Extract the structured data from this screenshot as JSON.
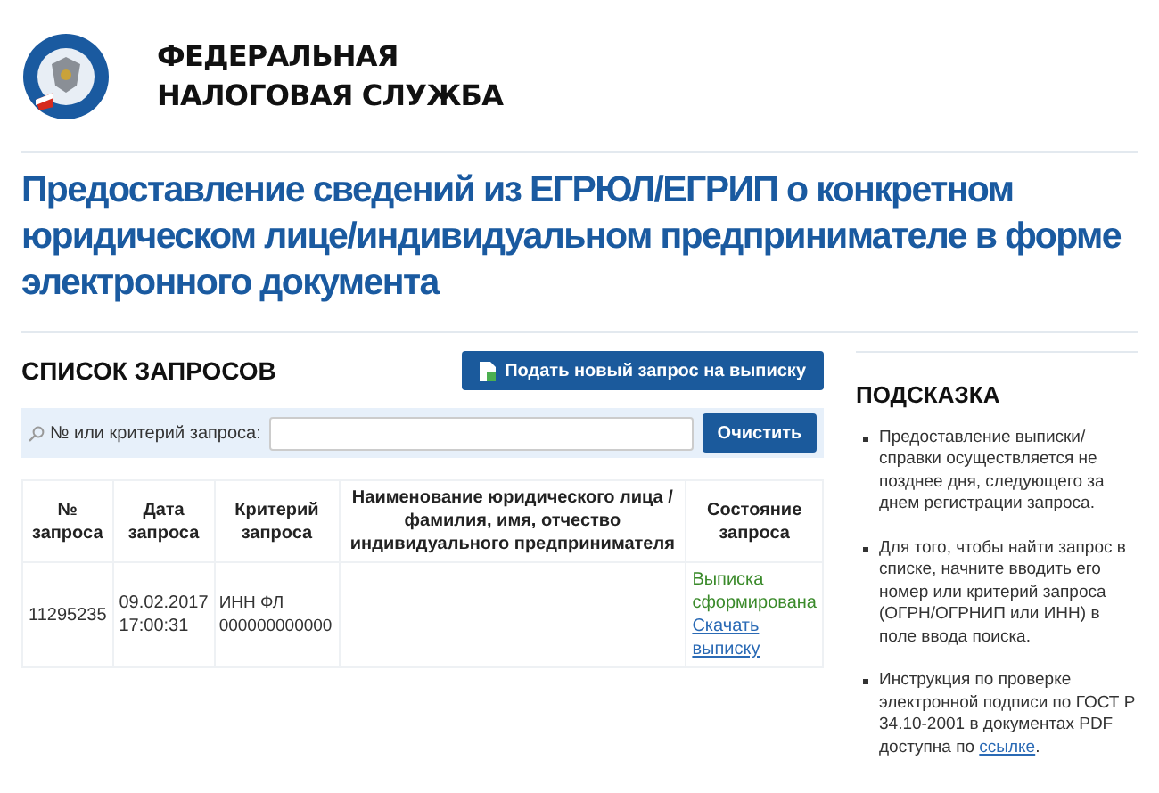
{
  "header": {
    "org_line1": "ФЕДЕРАЛЬНАЯ",
    "org_line2": "НАЛОГОВАЯ СЛУЖБА"
  },
  "page_title": "Предоставление сведений из ЕГРЮЛ/ЕГРИП о конкретном юридическом лице/индивидуальном предпринимателе в форме электронного документа",
  "requests": {
    "heading": "СПИСОК ЗАПРОСОВ",
    "new_request_button": "Подать новый запрос на выписку",
    "search": {
      "label": "№ или критерий запроса:",
      "clear_button": "Очистить"
    },
    "table": {
      "columns": [
        "№ запроса",
        "Дата запроса",
        "Критерий запроса",
        "Наименование юридического лица / фамилия, имя, отчество индивидуального предпринимателя",
        "Состояние запроса"
      ],
      "rows": [
        {
          "number": "11295235",
          "date": "09.02.2017",
          "time": "17:00:31",
          "criterion": "ИНН ФЛ 000000000000",
          "status": "Выписка сформирована",
          "download_link": "Скачать выписку"
        }
      ]
    }
  },
  "hint": {
    "heading": "ПОДСКАЗКА",
    "items": [
      {
        "text": "Предоставление выписки/ справки осуществляется не позднее дня, следующего за днем регистрации запроса."
      },
      {
        "text": "Для того, чтобы найти запрос в списке, начните вводить его номер или критерий запроса (ОГРН/ОГРНИП или ИНН) в поле ввода поиска."
      },
      {
        "text": "Инструкция по проверке электронной подписи по ГОСТ Р 34.10-2001 в документах PDF доступна по ",
        "link": "ссылке",
        "after": "."
      }
    ]
  }
}
